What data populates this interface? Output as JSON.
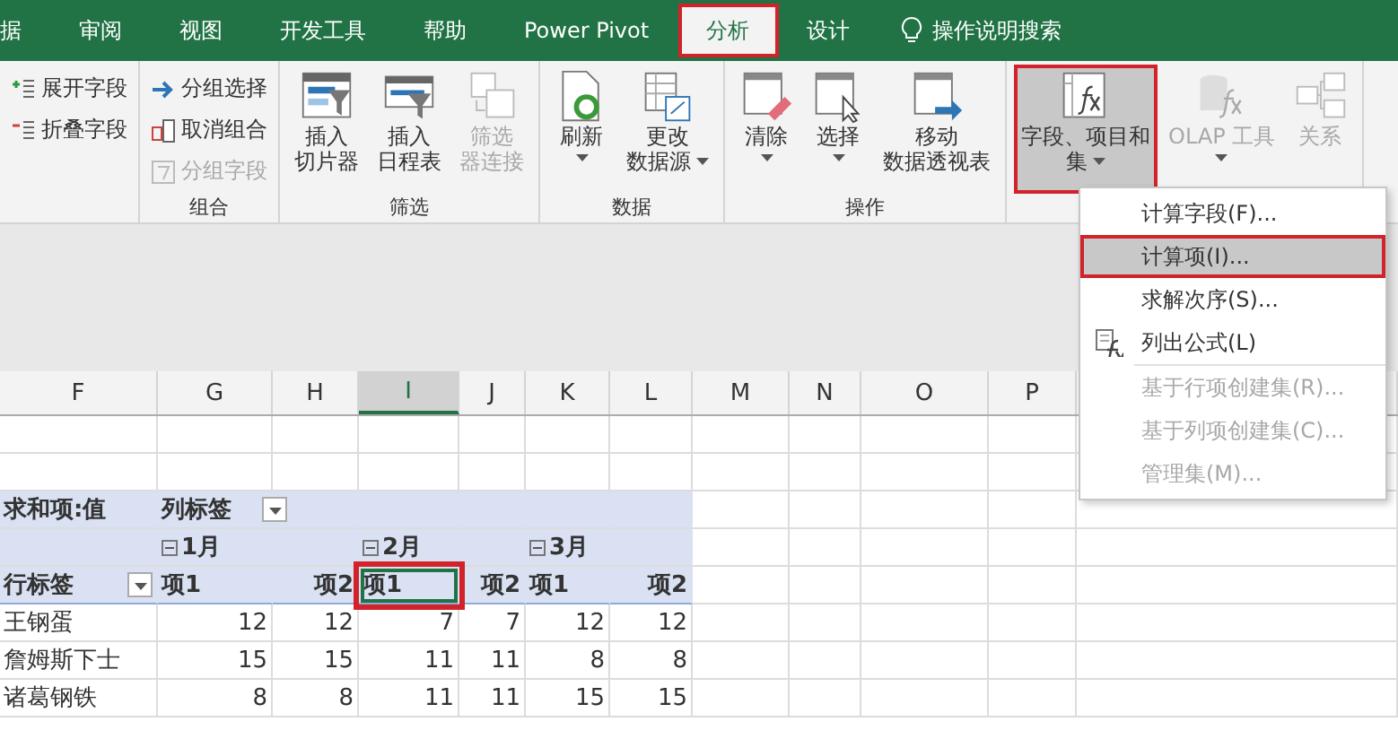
{
  "tabs": [
    {
      "label": "据",
      "selected": false,
      "highlighted": false
    },
    {
      "label": "审阅",
      "selected": false,
      "highlighted": false
    },
    {
      "label": "视图",
      "selected": false,
      "highlighted": false
    },
    {
      "label": "开发工具",
      "selected": false,
      "highlighted": false
    },
    {
      "label": "帮助",
      "selected": false,
      "highlighted": false
    },
    {
      "label": "Power Pivot",
      "selected": false,
      "highlighted": false
    },
    {
      "label": "分析",
      "selected": true,
      "highlighted": true
    },
    {
      "label": "设计",
      "selected": false,
      "highlighted": false
    }
  ],
  "tell_me": "操作说明搜索",
  "ribbon_groups": [
    {
      "items": [
        {
          "kind": "small",
          "label": "展开字段",
          "disabled": false
        },
        {
          "kind": "small",
          "label": "折叠字段",
          "disabled": false
        }
      ]
    },
    {
      "label": "组合",
      "items": [
        {
          "kind": "small",
          "label": "分组选择",
          "disabled": false
        },
        {
          "kind": "small",
          "label": "取消组合",
          "disabled": false
        },
        {
          "kind": "small",
          "label": "分组字段",
          "disabled": true
        }
      ]
    },
    {
      "label": "筛选",
      "items": [
        {
          "kind": "large",
          "lines": [
            "插入",
            "切片器"
          ],
          "disabled": false,
          "dropdown": false,
          "highlighted": false
        },
        {
          "kind": "large",
          "lines": [
            "插入",
            "日程表"
          ],
          "disabled": false,
          "dropdown": false,
          "highlighted": false
        },
        {
          "kind": "large",
          "lines": [
            "筛选",
            "器连接"
          ],
          "disabled": true,
          "dropdown": false,
          "highlighted": false
        }
      ]
    },
    {
      "label": "数据",
      "items": [
        {
          "kind": "large",
          "lines": [
            "刷新"
          ],
          "disabled": false,
          "dropdown": true,
          "highlighted": false
        },
        {
          "kind": "large",
          "lines": [
            "更改",
            "数据源"
          ],
          "disabled": false,
          "dropdown": true,
          "highlighted": false
        }
      ]
    },
    {
      "label": "操作",
      "items": [
        {
          "kind": "large",
          "lines": [
            "清除"
          ],
          "disabled": false,
          "dropdown": true,
          "highlighted": false
        },
        {
          "kind": "large",
          "lines": [
            "选择"
          ],
          "disabled": false,
          "dropdown": true,
          "highlighted": false
        },
        {
          "kind": "large",
          "lines": [
            "移动",
            "数据透视表"
          ],
          "disabled": false,
          "dropdown": false,
          "highlighted": false
        }
      ]
    },
    {
      "items": [
        {
          "kind": "large",
          "lines": [
            "字段、项目和",
            "集"
          ],
          "disabled": false,
          "dropdown": true,
          "highlighted": true
        },
        {
          "kind": "large",
          "lines": [
            "OLAP 工具"
          ],
          "disabled": true,
          "dropdown": true,
          "highlighted": false
        },
        {
          "kind": "large",
          "lines": [
            "关系"
          ],
          "disabled": true,
          "dropdown": false,
          "highlighted": false
        }
      ]
    }
  ],
  "menu": [
    {
      "label": "计算字段(F)...",
      "disabled": false,
      "highlighted": false,
      "icon": false
    },
    {
      "label": "计算项(I)...",
      "disabled": false,
      "highlighted": true,
      "icon": false
    },
    {
      "label": "求解次序(S)...",
      "disabled": false,
      "highlighted": false,
      "icon": false
    },
    {
      "label": "列出公式(L)",
      "disabled": false,
      "highlighted": false,
      "icon": true
    },
    {
      "label": "基于行项创建集(R)...",
      "disabled": true,
      "highlighted": false,
      "icon": false
    },
    {
      "label": "基于列项创建集(C)...",
      "disabled": true,
      "highlighted": false,
      "icon": false
    },
    {
      "label": "管理集(M)...",
      "disabled": true,
      "highlighted": false,
      "icon": false
    }
  ],
  "columns": [
    {
      "label": "F",
      "selected": false
    },
    {
      "label": "G",
      "selected": false
    },
    {
      "label": "H",
      "selected": false
    },
    {
      "label": "I",
      "selected": true
    },
    {
      "label": "J",
      "selected": false
    },
    {
      "label": "K",
      "selected": false
    },
    {
      "label": "L",
      "selected": false
    },
    {
      "label": "M",
      "selected": false
    },
    {
      "label": "N",
      "selected": false
    },
    {
      "label": "O",
      "selected": false
    },
    {
      "label": "P",
      "selected": false
    }
  ],
  "pivot": {
    "corner": "求和项:值",
    "column_label": "列标签",
    "months": [
      "1月",
      "2月",
      "3月"
    ],
    "row_label": "行标签",
    "items": [
      {
        "label": "项1",
        "selected": false
      },
      {
        "label": "项2",
        "selected": false
      },
      {
        "label": "项1",
        "selected": true
      },
      {
        "label": "项2",
        "selected": false
      },
      {
        "label": "项1",
        "selected": false
      },
      {
        "label": "项2",
        "selected": false
      }
    ],
    "rows": [
      {
        "name": "王钢蛋",
        "values": [
          "12",
          "12",
          "7",
          "7",
          "12",
          "12"
        ]
      },
      {
        "name": "詹姆斯下士",
        "values": [
          "15",
          "15",
          "11",
          "11",
          "8",
          "8"
        ]
      },
      {
        "name": "诸葛钢铁",
        "values": [
          "8",
          "8",
          "11",
          "11",
          "15",
          "15"
        ]
      }
    ]
  }
}
